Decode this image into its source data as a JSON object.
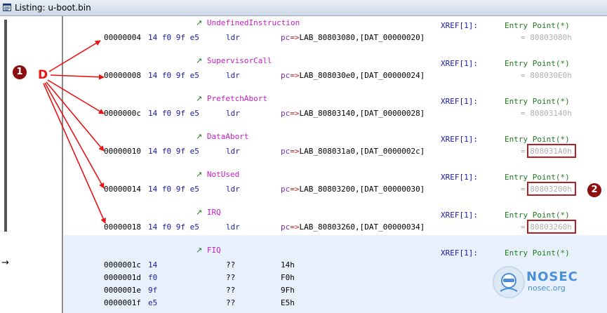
{
  "window": {
    "title": "Listing:  u-boot.bin"
  },
  "annotations": {
    "d_label": "D",
    "badge1": "1",
    "badge2": "2"
  },
  "logo": {
    "name": "NOSEC",
    "domain": "nosec.org"
  },
  "blocks": [
    {
      "label": "UndefinedInstruction",
      "xref": "XREF[1]:",
      "entry": "Entry Point(*)",
      "addr": "00000004",
      "bytes": "14 f0 9f e5",
      "mnemonic": "ldr",
      "op_pc": "pc",
      "op_arrow": "=>",
      "op_rest": "LAB_80803080,[DAT_00000020]",
      "eq": "= 80803080h"
    },
    {
      "label": "SupervisorCall",
      "xref": "XREF[1]:",
      "entry": "Entry Point(*)",
      "addr": "00000008",
      "bytes": "14 f0 9f e5",
      "mnemonic": "ldr",
      "op_pc": "pc",
      "op_arrow": "=>",
      "op_rest": "LAB_808030e0,[DAT_00000024]",
      "eq": "= 808030E0h"
    },
    {
      "label": "PrefetchAbort",
      "xref": "XREF[1]:",
      "entry": "Entry Point(*)",
      "addr": "0000000c",
      "bytes": "14 f0 9f e5",
      "mnemonic": "ldr",
      "op_pc": "pc",
      "op_arrow": "=>",
      "op_rest": "LAB_80803140,[DAT_00000028]",
      "eq": "= 80803140h"
    },
    {
      "label": "DataAbort",
      "xref": "XREF[1]:",
      "entry": "Entry Point(*)",
      "addr": "00000010",
      "bytes": "14 f0 9f e5",
      "mnemonic": "ldr",
      "op_pc": "pc",
      "op_arrow": "=>",
      "op_rest": "LAB_808031a0,[DAT_0000002c]",
      "eq": "= 808031A0h"
    },
    {
      "label": "NotUsed",
      "xref": "XREF[1]:",
      "entry": "Entry Point(*)",
      "addr": "00000014",
      "bytes": "14 f0 9f e5",
      "mnemonic": "ldr",
      "op_pc": "pc",
      "op_arrow": "=>",
      "op_rest": "LAB_80803200,[DAT_00000030]",
      "eq": "= 80803200h"
    },
    {
      "label": "IRQ",
      "xref": "XREF[1]:",
      "entry": "Entry Point(*)",
      "addr": "00000018",
      "bytes": "14 f0 9f e5",
      "mnemonic": "ldr",
      "op_pc": "pc",
      "op_arrow": "=>",
      "op_rest": "LAB_80803260,[DAT_00000034]",
      "eq": "= 80803260h"
    }
  ],
  "fiq": {
    "label": "FIQ",
    "xref": "XREF[1]:",
    "entry": "Entry Point(*)",
    "rows": [
      {
        "addr": "0000001c",
        "byte": "14",
        "mn": "??",
        "val": "14h"
      },
      {
        "addr": "0000001d",
        "byte": "f0",
        "mn": "??",
        "val": "F0h"
      },
      {
        "addr": "0000001e",
        "byte": "9f",
        "mn": "??",
        "val": "9Fh"
      },
      {
        "addr": "0000001f",
        "byte": "e5",
        "mn": "??",
        "val": "E5h"
      }
    ]
  }
}
